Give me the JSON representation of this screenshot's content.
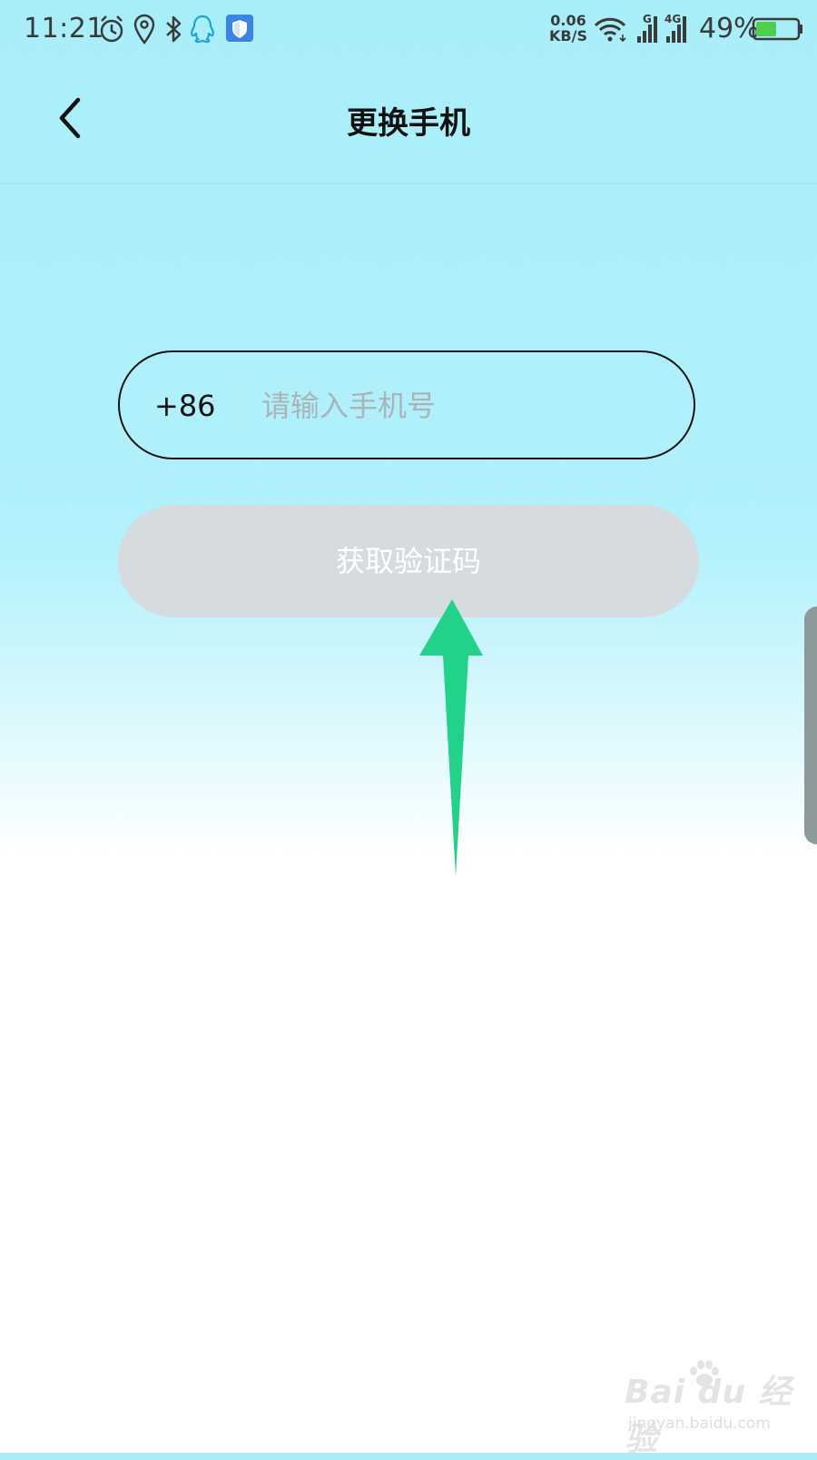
{
  "status_bar": {
    "time": "11:21",
    "net_speed_value": "0.06",
    "net_speed_unit": "KB/S",
    "signal_labels": [
      "G",
      "4G"
    ],
    "battery_percent": "49%",
    "battery_level": 0.49,
    "icons": [
      "alarm-icon",
      "location-icon",
      "bluetooth-icon",
      "qq-icon",
      "shield-icon",
      "wifi-icon",
      "signal-icon",
      "battery-icon"
    ]
  },
  "header": {
    "title": "更换手机"
  },
  "phone_form": {
    "country_code": "+86",
    "phone_placeholder": "请输入手机号",
    "phone_value": "",
    "get_code_label": "获取验证码"
  },
  "watermark": {
    "brand": "Bai du 经验",
    "url": "jingyan.baidu.com"
  },
  "colors": {
    "background_top": "#a8eef9",
    "button_disabled": "#d6dbe0",
    "arrow": "#22d18a",
    "border": "#111111"
  }
}
